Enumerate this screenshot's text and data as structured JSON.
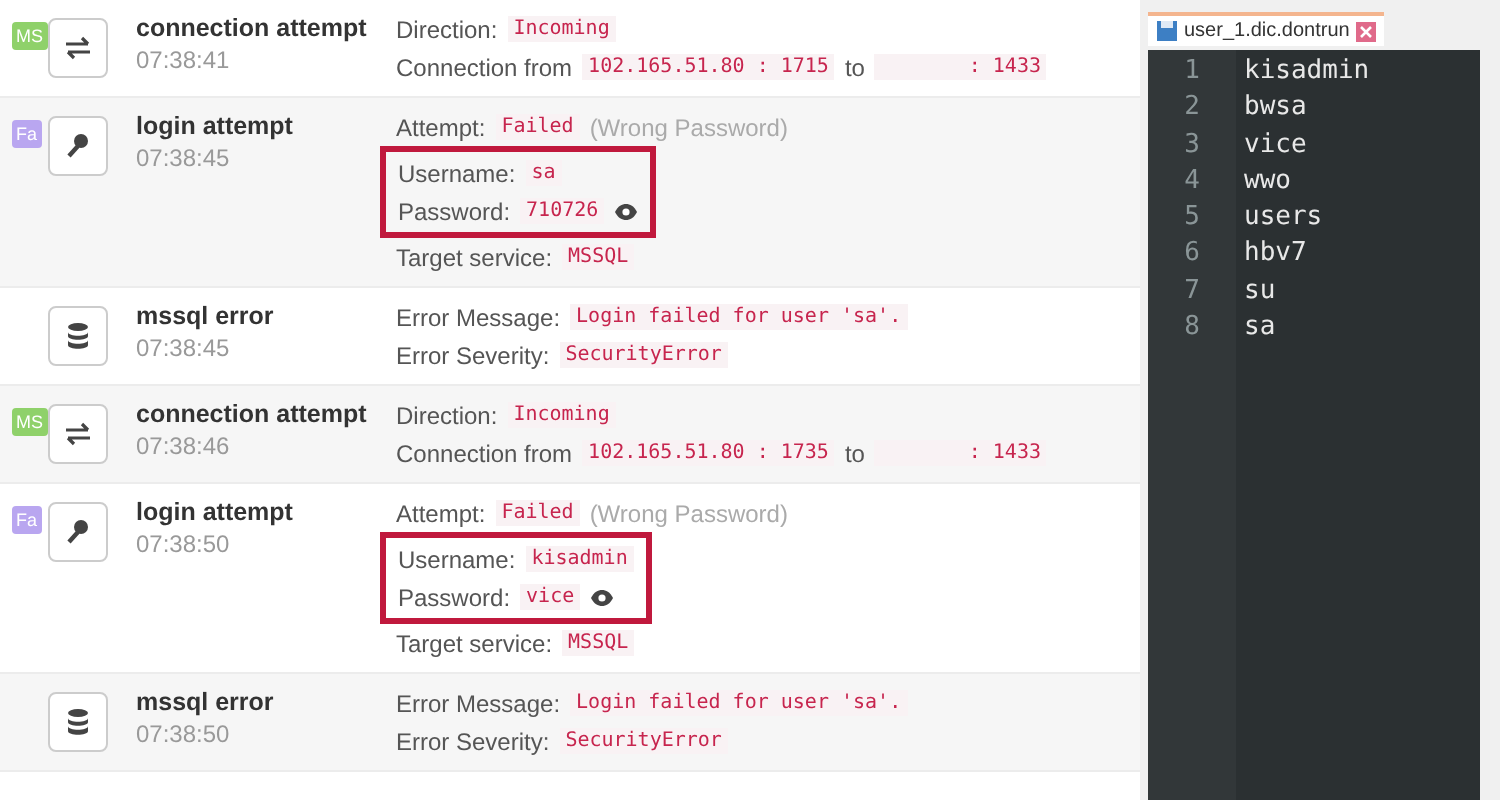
{
  "events": [
    {
      "badge": {
        "text": "MS",
        "color": "#8fd16a"
      },
      "kind": "connection",
      "title": "connection attempt",
      "time": "07:38:41",
      "lines": [
        {
          "kind": "line",
          "parts": [
            {
              "kind": "label",
              "text": "Direction:"
            },
            {
              "kind": "value",
              "text": "Incoming"
            }
          ]
        },
        {
          "kind": "line",
          "parts": [
            {
              "kind": "label",
              "text": "Connection from"
            },
            {
              "kind": "value",
              "text": "102.165.51.80 : 1715"
            },
            {
              "kind": "label",
              "text": "to"
            },
            {
              "kind": "masked-value",
              "text": ": 1433"
            }
          ]
        }
      ]
    },
    {
      "badge": {
        "text": "Fa",
        "color": "#b9a6f0"
      },
      "kind": "login",
      "title": "login attempt",
      "time": "07:38:45",
      "lines": [
        {
          "kind": "line",
          "parts": [
            {
              "kind": "label",
              "text": "Attempt:"
            },
            {
              "kind": "value",
              "text": "Failed"
            },
            {
              "kind": "note",
              "text": "(Wrong Password)"
            }
          ]
        },
        {
          "kind": "frame",
          "lines": [
            {
              "kind": "line",
              "parts": [
                {
                  "kind": "label",
                  "text": "Username:"
                },
                {
                  "kind": "value",
                  "text": "sa"
                }
              ]
            },
            {
              "kind": "line",
              "parts": [
                {
                  "kind": "label",
                  "text": "Password:"
                },
                {
                  "kind": "value",
                  "text": "710726"
                },
                {
                  "kind": "eye"
                }
              ]
            }
          ]
        },
        {
          "kind": "line",
          "parts": [
            {
              "kind": "label",
              "text": "Target service:"
            },
            {
              "kind": "value",
              "text": "MSSQL"
            }
          ]
        }
      ]
    },
    {
      "kind": "error",
      "title": "mssql error",
      "time": "07:38:45",
      "lines": [
        {
          "kind": "line",
          "parts": [
            {
              "kind": "label",
              "text": "Error Message:"
            },
            {
              "kind": "value",
              "text": "Login failed for user 'sa'."
            }
          ]
        },
        {
          "kind": "line",
          "parts": [
            {
              "kind": "label",
              "text": "Error Severity:"
            },
            {
              "kind": "value",
              "text": "SecurityError"
            }
          ]
        }
      ]
    },
    {
      "badge": {
        "text": "MS",
        "color": "#8fd16a"
      },
      "kind": "connection",
      "title": "connection attempt",
      "time": "07:38:46",
      "lines": [
        {
          "kind": "line",
          "parts": [
            {
              "kind": "label",
              "text": "Direction:"
            },
            {
              "kind": "value",
              "text": "Incoming"
            }
          ]
        },
        {
          "kind": "line",
          "parts": [
            {
              "kind": "label",
              "text": "Connection from"
            },
            {
              "kind": "value",
              "text": "102.165.51.80 : 1735"
            },
            {
              "kind": "label",
              "text": "to"
            },
            {
              "kind": "masked-value",
              "text": ": 1433"
            }
          ]
        }
      ]
    },
    {
      "badge": {
        "text": "Fa",
        "color": "#b9a6f0"
      },
      "kind": "login",
      "title": "login attempt",
      "time": "07:38:50",
      "lines": [
        {
          "kind": "line",
          "parts": [
            {
              "kind": "label",
              "text": "Attempt:"
            },
            {
              "kind": "value",
              "text": "Failed"
            },
            {
              "kind": "note",
              "text": "(Wrong Password)"
            }
          ]
        },
        {
          "kind": "frame",
          "lines": [
            {
              "kind": "line",
              "parts": [
                {
                  "kind": "label",
                  "text": "Username:"
                },
                {
                  "kind": "value",
                  "text": "kisadmin"
                }
              ]
            },
            {
              "kind": "line",
              "parts": [
                {
                  "kind": "label",
                  "text": "Password:"
                },
                {
                  "kind": "value",
                  "text": "vice"
                },
                {
                  "kind": "eye"
                }
              ]
            }
          ]
        },
        {
          "kind": "line",
          "parts": [
            {
              "kind": "label",
              "text": "Target service:"
            },
            {
              "kind": "value",
              "text": "MSSQL"
            }
          ]
        }
      ]
    },
    {
      "kind": "error",
      "title": "mssql error",
      "time": "07:38:50",
      "lines": [
        {
          "kind": "line",
          "parts": [
            {
              "kind": "label",
              "text": "Error Message:"
            },
            {
              "kind": "value",
              "text": "Login failed for user 'sa'."
            }
          ]
        },
        {
          "kind": "line",
          "parts": [
            {
              "kind": "label",
              "text": "Error Severity:"
            },
            {
              "kind": "value",
              "text": "SecurityError"
            }
          ]
        }
      ]
    }
  ],
  "editor": {
    "tab": "user_1.dic.dontrun",
    "lines": [
      {
        "number": "1",
        "text": "kisadmin"
      },
      {
        "number": "2",
        "text": "bwsa"
      },
      {
        "number": "3",
        "text": "vice"
      },
      {
        "number": "4",
        "text": "wwo"
      },
      {
        "number": "5",
        "text": "users"
      },
      {
        "number": "6",
        "text": "hbv7"
      },
      {
        "number": "7",
        "text": "su"
      },
      {
        "number": "8",
        "text": "sa"
      }
    ]
  }
}
